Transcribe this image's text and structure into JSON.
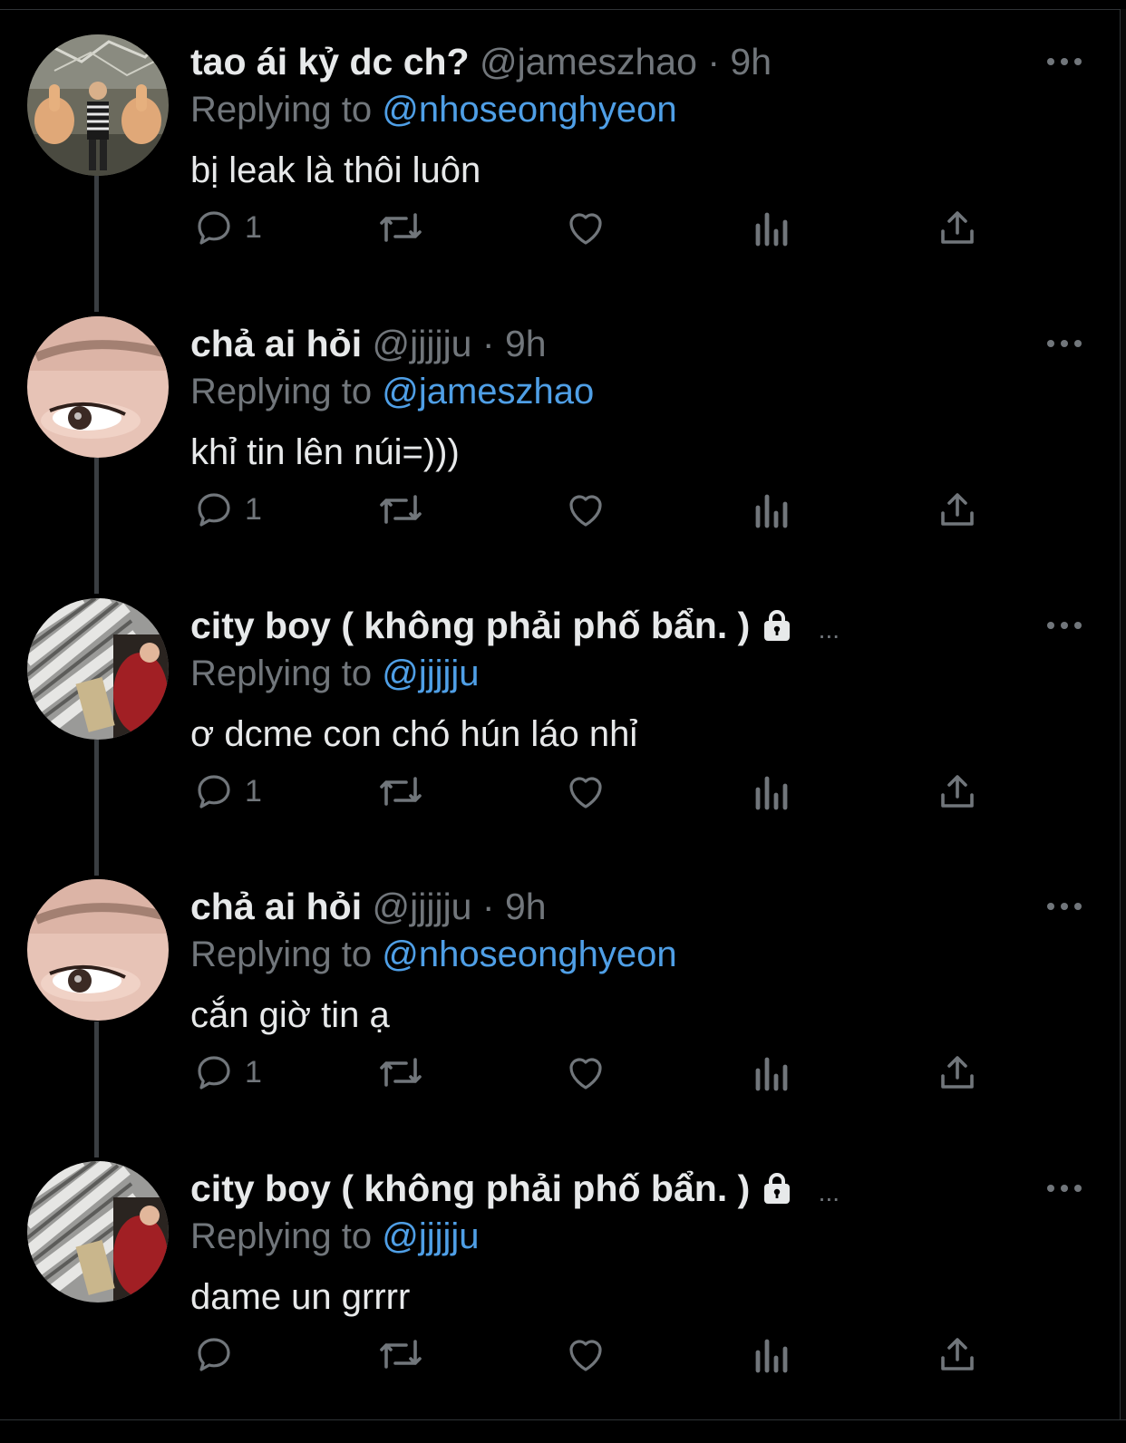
{
  "colors": {
    "background": "#000000",
    "text_primary": "#e7e9ea",
    "text_secondary": "#71767b",
    "mention": "#4f9fe6",
    "thread_line": "#3a3e42"
  },
  "labels": {
    "replying_to": "Replying to"
  },
  "tweets": [
    {
      "name": "tao ái kỷ dc ch?",
      "handle": "@jameszhao",
      "dot": "·",
      "time": "9h",
      "locked": false,
      "truncated": false,
      "replying_to": "@nhoseonghyeon",
      "text": "bị leak là thôi luôn",
      "reply_count": "1",
      "avatar": "avatar-thumbs-up"
    },
    {
      "name": "chả ai hỏi",
      "handle": "@jjjjju",
      "dot": "·",
      "time": "9h",
      "locked": false,
      "truncated": false,
      "replying_to": "@jameszhao",
      "text": "khỉ tin lên núi=)))",
      "reply_count": "1",
      "avatar": "avatar-eye"
    },
    {
      "name": "city boy ( không phải phố bẩn. )",
      "handle": "",
      "dot": "",
      "time": "",
      "locked": true,
      "truncated": true,
      "ellipsis": "...",
      "replying_to": "@jjjjju",
      "text": "ơ dcme con chó hún láo nhỉ",
      "reply_count": "1",
      "avatar": "avatar-red-shirt"
    },
    {
      "name": "chả ai hỏi",
      "handle": "@jjjjju",
      "dot": "·",
      "time": "9h",
      "locked": false,
      "truncated": false,
      "replying_to": "@nhoseonghyeon",
      "text": "cắn giờ tin ạ",
      "reply_count": "1",
      "avatar": "avatar-eye"
    },
    {
      "name": "city boy ( không phải phố bẩn. )",
      "handle": "",
      "dot": "",
      "time": "",
      "locked": true,
      "truncated": true,
      "ellipsis": "...",
      "replying_to": "@jjjjju",
      "text": "dame un grrrr",
      "reply_count": "",
      "avatar": "avatar-red-shirt"
    }
  ],
  "action_icons": [
    "reply-icon",
    "retweet-icon",
    "like-icon",
    "views-icon",
    "share-icon"
  ]
}
